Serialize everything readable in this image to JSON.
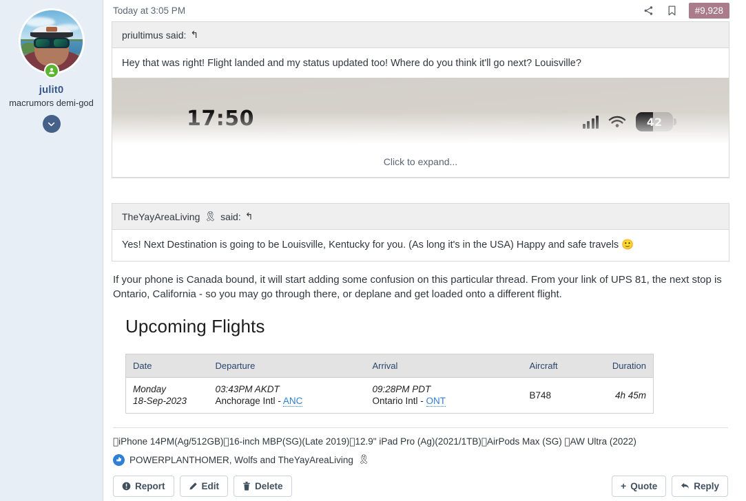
{
  "sidebar": {
    "username": "julit0",
    "user_title": "macrumors demi-god",
    "online_status_icon": "user-online-icon",
    "expand_icon": "chevron-down-icon"
  },
  "post_header": {
    "timestamp": "Today at 3:05 PM",
    "share_icon": "share-icon",
    "bookmark_icon": "bookmark-icon",
    "post_number": "#9,928"
  },
  "quotes": [
    {
      "author": "priultimus said:",
      "reply_icon": "reply-arrow-icon",
      "text": "Hey that was right! Flight landed and my status updated too! Where do you think it'll go next? Louisville?",
      "expand_label": "Click to expand...",
      "embedded_image": {
        "clock": "17:50",
        "signal_icon": "cellular-signal-icon",
        "wifi_icon": "wifi-icon",
        "battery_percent": "42",
        "battery_fill_ratio": 0.46
      }
    },
    {
      "author": "TheYayAreaLiving",
      "author_badge": "🎗",
      "said_label": "said:",
      "reply_icon": "reply-arrow-icon",
      "text": "Yes! Next Destination is going to be Louisville, Kentucky for you. (As long it's in the USA) Happy and safe travels",
      "emoji": "🙂"
    }
  ],
  "post_body": "If your phone is Canada bound, it will start adding some confusion on this particular thread. From your link of UPS 81, the next stop is Ontario, California - so you may go through there, or deplane and get loaded onto a different flight.",
  "flights": {
    "heading": "Upcoming Flights",
    "columns": [
      "Date",
      "Departure",
      "Arrival",
      "Aircraft",
      "Duration"
    ],
    "rows": [
      {
        "date_day": "Monday",
        "date_value": "18-Sep-2023",
        "departure_time": "03:43PM AKDT",
        "departure_airport": "Anchorage Intl",
        "departure_code": "ANC",
        "arrival_time": "09:28PM PDT",
        "arrival_airport": "Ontario Intl",
        "arrival_code": "ONT",
        "aircraft": "B748",
        "duration": "4h 45m"
      }
    ]
  },
  "signature": {
    "items": [
      "iPhone 14PM(Ag/512GB)",
      "16-inch MBP(SG)(Late 2019)",
      "12.9\" iPad Pro (Ag)(2021/1TB)",
      "AirPods Max (SG)",
      "AW Ultra (2022)"
    ],
    "apple_glyph": ""
  },
  "reactions": {
    "icon": "thumbs-up-icon",
    "text": "POWERPLANTHOMER, Wolfs and TheYayAreaLiving",
    "badge": "🎗"
  },
  "actions": {
    "report": "Report",
    "edit": "Edit",
    "delete": "Delete",
    "quote": "Quote",
    "reply": "Reply"
  },
  "colors": {
    "sidebar_bg": "#e8eef5",
    "username": "#36588a",
    "post_number_bg": "#a97b8b",
    "link": "#2f7fd4",
    "table_header_text": "#29456b",
    "online_green": "#5cb531"
  }
}
